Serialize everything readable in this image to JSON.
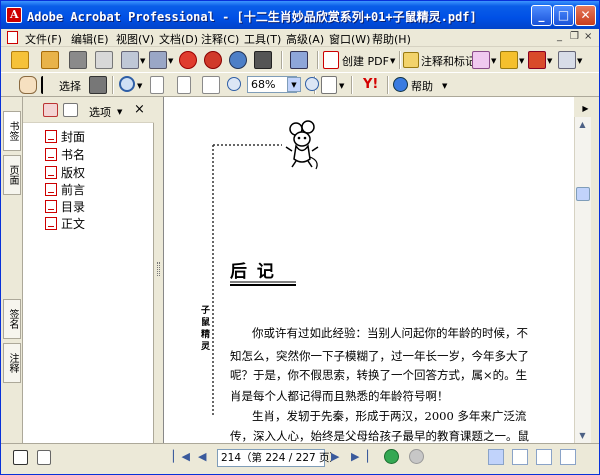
{
  "window": {
    "title": "Adobe Acrobat Professional - [十二生肖妙品欣赏系列+01+子鼠精灵.pdf]",
    "controls": {
      "minimize": "_",
      "maximize": "□",
      "close": "✕"
    }
  },
  "menu": {
    "items": [
      "文件(F)",
      "编辑(E)",
      "视图(V)",
      "文档(D)",
      "注释(C)",
      "工具(T)",
      "高级(A)",
      "窗口(W)",
      "帮助(H)"
    ],
    "mdi_controls": {
      "minimize": "_",
      "restore": "❐",
      "close": "×"
    }
  },
  "toolbar1": {
    "create_pdf": "创建 PDF",
    "comment_markup": "注释和标记"
  },
  "toolbar2": {
    "select": "选择",
    "zoom_value": "68%",
    "help": "帮助"
  },
  "nav": {
    "tabs": [
      "书签",
      "页面",
      "签名",
      "注释"
    ],
    "options": "选项",
    "close": "×",
    "bookmarks": [
      "封面",
      "书名",
      "版权",
      "前言",
      "目录",
      "正文"
    ]
  },
  "doc": {
    "vertical_title": "子鼠精灵",
    "heading": "后  记",
    "lines": [
      "你或许有过如此经验：当别人问起你的年龄的时候，不",
      "知怎么，突然你一下子模糊了，过一年长一岁，今年多大了",
      "呢？于是，你不假思索，转换了一个回答方式，属×的。生",
      "肖是每个人都记得而且熟悉的年龄符号啊！",
      "生肖，发轫于先秦，形成于两汉，2000 多年来广泛流",
      "传，深入人心，始终是父母给孩子最早的教育课题之一。鼠"
    ]
  },
  "status": {
    "page_box": "214（第 224 / 227 页）"
  },
  "colors": {
    "titlebar": "#0a5ee8",
    "chrome": "#ece9d8",
    "acrobat_red": "#cc0000"
  }
}
